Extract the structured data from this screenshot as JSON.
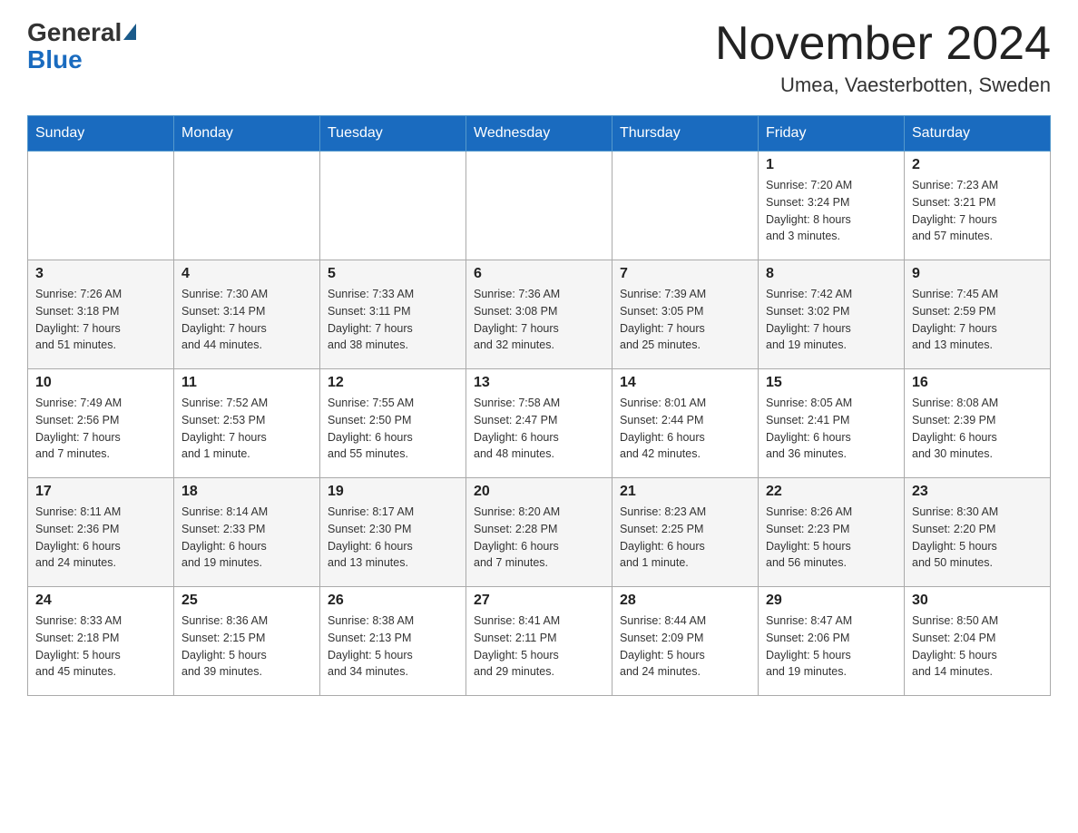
{
  "header": {
    "logo_general": "General",
    "logo_blue": "Blue",
    "month_title": "November 2024",
    "location": "Umea, Vaesterbotten, Sweden"
  },
  "calendar": {
    "days_of_week": [
      "Sunday",
      "Monday",
      "Tuesday",
      "Wednesday",
      "Thursday",
      "Friday",
      "Saturday"
    ],
    "weeks": [
      [
        {
          "day": "",
          "info": ""
        },
        {
          "day": "",
          "info": ""
        },
        {
          "day": "",
          "info": ""
        },
        {
          "day": "",
          "info": ""
        },
        {
          "day": "",
          "info": ""
        },
        {
          "day": "1",
          "info": "Sunrise: 7:20 AM\nSunset: 3:24 PM\nDaylight: 8 hours\nand 3 minutes."
        },
        {
          "day": "2",
          "info": "Sunrise: 7:23 AM\nSunset: 3:21 PM\nDaylight: 7 hours\nand 57 minutes."
        }
      ],
      [
        {
          "day": "3",
          "info": "Sunrise: 7:26 AM\nSunset: 3:18 PM\nDaylight: 7 hours\nand 51 minutes."
        },
        {
          "day": "4",
          "info": "Sunrise: 7:30 AM\nSunset: 3:14 PM\nDaylight: 7 hours\nand 44 minutes."
        },
        {
          "day": "5",
          "info": "Sunrise: 7:33 AM\nSunset: 3:11 PM\nDaylight: 7 hours\nand 38 minutes."
        },
        {
          "day": "6",
          "info": "Sunrise: 7:36 AM\nSunset: 3:08 PM\nDaylight: 7 hours\nand 32 minutes."
        },
        {
          "day": "7",
          "info": "Sunrise: 7:39 AM\nSunset: 3:05 PM\nDaylight: 7 hours\nand 25 minutes."
        },
        {
          "day": "8",
          "info": "Sunrise: 7:42 AM\nSunset: 3:02 PM\nDaylight: 7 hours\nand 19 minutes."
        },
        {
          "day": "9",
          "info": "Sunrise: 7:45 AM\nSunset: 2:59 PM\nDaylight: 7 hours\nand 13 minutes."
        }
      ],
      [
        {
          "day": "10",
          "info": "Sunrise: 7:49 AM\nSunset: 2:56 PM\nDaylight: 7 hours\nand 7 minutes."
        },
        {
          "day": "11",
          "info": "Sunrise: 7:52 AM\nSunset: 2:53 PM\nDaylight: 7 hours\nand 1 minute."
        },
        {
          "day": "12",
          "info": "Sunrise: 7:55 AM\nSunset: 2:50 PM\nDaylight: 6 hours\nand 55 minutes."
        },
        {
          "day": "13",
          "info": "Sunrise: 7:58 AM\nSunset: 2:47 PM\nDaylight: 6 hours\nand 48 minutes."
        },
        {
          "day": "14",
          "info": "Sunrise: 8:01 AM\nSunset: 2:44 PM\nDaylight: 6 hours\nand 42 minutes."
        },
        {
          "day": "15",
          "info": "Sunrise: 8:05 AM\nSunset: 2:41 PM\nDaylight: 6 hours\nand 36 minutes."
        },
        {
          "day": "16",
          "info": "Sunrise: 8:08 AM\nSunset: 2:39 PM\nDaylight: 6 hours\nand 30 minutes."
        }
      ],
      [
        {
          "day": "17",
          "info": "Sunrise: 8:11 AM\nSunset: 2:36 PM\nDaylight: 6 hours\nand 24 minutes."
        },
        {
          "day": "18",
          "info": "Sunrise: 8:14 AM\nSunset: 2:33 PM\nDaylight: 6 hours\nand 19 minutes."
        },
        {
          "day": "19",
          "info": "Sunrise: 8:17 AM\nSunset: 2:30 PM\nDaylight: 6 hours\nand 13 minutes."
        },
        {
          "day": "20",
          "info": "Sunrise: 8:20 AM\nSunset: 2:28 PM\nDaylight: 6 hours\nand 7 minutes."
        },
        {
          "day": "21",
          "info": "Sunrise: 8:23 AM\nSunset: 2:25 PM\nDaylight: 6 hours\nand 1 minute."
        },
        {
          "day": "22",
          "info": "Sunrise: 8:26 AM\nSunset: 2:23 PM\nDaylight: 5 hours\nand 56 minutes."
        },
        {
          "day": "23",
          "info": "Sunrise: 8:30 AM\nSunset: 2:20 PM\nDaylight: 5 hours\nand 50 minutes."
        }
      ],
      [
        {
          "day": "24",
          "info": "Sunrise: 8:33 AM\nSunset: 2:18 PM\nDaylight: 5 hours\nand 45 minutes."
        },
        {
          "day": "25",
          "info": "Sunrise: 8:36 AM\nSunset: 2:15 PM\nDaylight: 5 hours\nand 39 minutes."
        },
        {
          "day": "26",
          "info": "Sunrise: 8:38 AM\nSunset: 2:13 PM\nDaylight: 5 hours\nand 34 minutes."
        },
        {
          "day": "27",
          "info": "Sunrise: 8:41 AM\nSunset: 2:11 PM\nDaylight: 5 hours\nand 29 minutes."
        },
        {
          "day": "28",
          "info": "Sunrise: 8:44 AM\nSunset: 2:09 PM\nDaylight: 5 hours\nand 24 minutes."
        },
        {
          "day": "29",
          "info": "Sunrise: 8:47 AM\nSunset: 2:06 PM\nDaylight: 5 hours\nand 19 minutes."
        },
        {
          "day": "30",
          "info": "Sunrise: 8:50 AM\nSunset: 2:04 PM\nDaylight: 5 hours\nand 14 minutes."
        }
      ]
    ]
  }
}
